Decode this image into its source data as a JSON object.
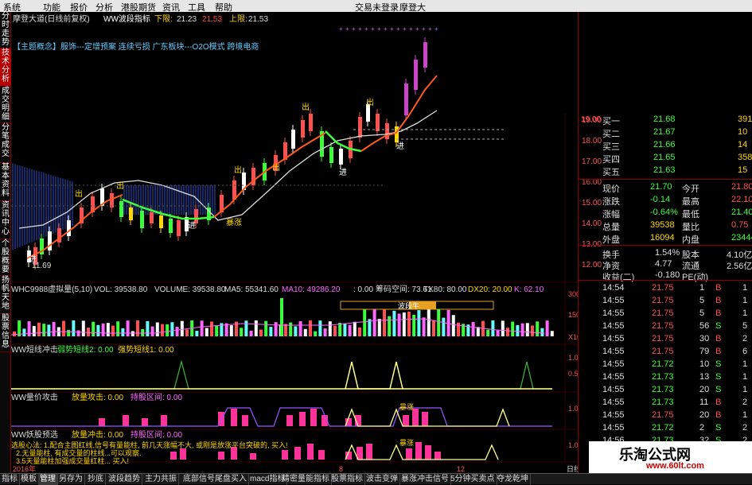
{
  "menu": {
    "items": [
      "系统",
      "功能",
      "报价",
      "分析",
      "港股期货",
      "资讯",
      "工具",
      "帮助"
    ],
    "status": "交易未登录",
    "app_title": "摩登大"
  },
  "side_tabs": [
    "分时走势",
    "技术分析",
    "成交明细",
    "分笔成交",
    "基本资料",
    "资讯中心",
    "个股概要",
    "扬帆天地",
    "股票信息"
  ],
  "chart": {
    "title": "摩登大道(日线前复权)",
    "indicator": "WW波段指标",
    "lower_label": "下限:",
    "lower_val": "21.23",
    "lower_val2": "21.53",
    "upper_label": "上限:",
    "upper_val": "21.53",
    "themes": "【主题概念】服饰---定增预案 连续亏损 广东板块---O2O模式 跨境电商",
    "low_price": "11.69",
    "price_axis": [
      "19.00",
      "18.00",
      "17.00",
      "16.00",
      "15.00",
      "14.00",
      "13.00",
      "12.00"
    ],
    "annotations": [
      "出",
      "出",
      "出",
      "出",
      "出",
      "出",
      "进",
      "进",
      "进",
      "进",
      "暴涨"
    ],
    "vol_title": "WHC9988虚拟量(5,10)",
    "vol": "VOL: 39538.80",
    "volume": "VOLUME: 39538.80",
    "ma5": "MA5: 55341.60",
    "ma10": "MA10: 49286.20",
    "vol_extra": [
      ": 0.00",
      "筹码空间: 73.61",
      "TX80: 80.00",
      "DX20: 20.00",
      "K: 62.10"
    ],
    "vol_axis": [
      "30000",
      "15000",
      "X10"
    ],
    "vol_box_label": "波段牛",
    "ind1_title": "WW短线冲击",
    "ind1_a": "弱势短线2: 0.00",
    "ind1_b": "强势短线1: 0.00",
    "ind1_axis": [
      "1.00",
      "0.50"
    ],
    "ind2_title": "WW量价攻击",
    "ind2_a": "放量攻击: 0.00",
    "ind2_b": "持股区间: 0.00",
    "ind2_axis": [
      "1.00"
    ],
    "ind2_label": "暴涨",
    "ind3_title": "WW妖股预选",
    "ind3_a": "放量冲击: 0.00",
    "ind3_b": "持股区间: 0.00",
    "ind3_axis": [
      "1.00"
    ],
    "ind3_label": "暴涨",
    "notes1": "选股心法: 1.配合主图红线,信号有量能柱, 前几天涨幅不大, 或刚是放涨平台突破的, 买入!",
    "notes2": "2.无量能柱, 有成交量的柱线...可以观察.",
    "notes3": "3.5天量能柱加强成交量红柱... 买入!",
    "date_labels": [
      "2016年",
      "8",
      "12"
    ],
    "date_right": "日线"
  },
  "quotes": {
    "bid": [
      {
        "label": "买一",
        "price": "21.68",
        "vol": "391"
      },
      {
        "label": "买二",
        "price": "21.67",
        "vol": "10"
      },
      {
        "label": "买三",
        "price": "21.66",
        "vol": "14"
      },
      {
        "label": "买四",
        "price": "21.65",
        "vol": "358"
      },
      {
        "label": "买五",
        "price": "21.63",
        "vol": "15"
      }
    ],
    "stats": [
      {
        "a": "现价",
        "b": "21.70",
        "c": "今开",
        "d": "21.80"
      },
      {
        "a": "涨跌",
        "b": "-0.14",
        "c": "最高",
        "d": "22.10"
      },
      {
        "a": "涨幅",
        "b": "-0.64%",
        "c": "最低",
        "d": "21.40"
      },
      {
        "a": "总量",
        "b": "39538",
        "c": "量比",
        "d": "0.75"
      },
      {
        "a": "外盘",
        "b": "16094",
        "c": "内盘",
        "d": "23444"
      }
    ],
    "stats2": [
      {
        "a": "换手",
        "b": "1.54%",
        "c": "股本",
        "d": "4.10亿"
      },
      {
        "a": "净资",
        "b": "4.77",
        "c": "流通",
        "d": "2.56亿"
      },
      {
        "a": "收益(二)",
        "b": "-0.180",
        "c": "PE(动)",
        "d": ""
      }
    ],
    "ticks": [
      {
        "t": "14:54",
        "p": "21.75",
        "v": "1",
        "bs": "B",
        "n": "1"
      },
      {
        "t": "14:55",
        "p": "21.75",
        "v": "5",
        "bs": "B",
        "n": "1"
      },
      {
        "t": "14:55",
        "p": "21.75",
        "v": "5",
        "bs": "B",
        "n": "1"
      },
      {
        "t": "14:55",
        "p": "21.75",
        "v": "56",
        "bs": "S",
        "n": "5"
      },
      {
        "t": "14:55",
        "p": "21.75",
        "v": "30",
        "bs": "B",
        "n": "2"
      },
      {
        "t": "14:55",
        "p": "21.75",
        "v": "79",
        "bs": "B",
        "n": "6"
      },
      {
        "t": "14:55",
        "p": "21.72",
        "v": "10",
        "bs": "S",
        "n": "1"
      },
      {
        "t": "14:55",
        "p": "21.73",
        "v": "13",
        "bs": "S",
        "n": "1"
      },
      {
        "t": "14:55",
        "p": "21.73",
        "v": "20",
        "bs": "S",
        "n": "1"
      },
      {
        "t": "14:55",
        "p": "21.73",
        "v": "11",
        "bs": "B",
        "n": "2"
      },
      {
        "t": "14:55",
        "p": "21.75",
        "v": "20",
        "bs": "B",
        "n": "1"
      },
      {
        "t": "14:55",
        "p": "21.72",
        "v": "2",
        "bs": "S",
        "n": "2"
      },
      {
        "t": "14:56",
        "p": "21.73",
        "v": "32",
        "bs": "S",
        "n": "2"
      }
    ]
  },
  "bottom_tabs": [
    "指标",
    "模板",
    "管理",
    "另存为",
    "抄底",
    "波段趋势",
    "主力共振",
    "底部信号尾盘买入",
    "macd指标",
    "精密量能指标",
    "股票指标",
    "波击变弹",
    "暴涨冲击信号",
    "5分钟买卖点",
    "夺龙乾坤"
  ],
  "watermark": {
    "name": "乐淘公式网",
    "url": "www.60lt.com"
  }
}
